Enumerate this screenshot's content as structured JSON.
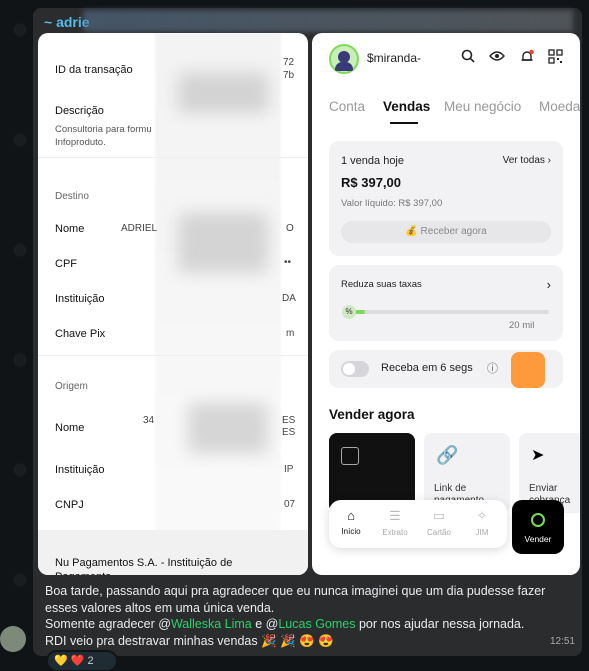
{
  "sender_name": "~ adrie",
  "left_screen": {
    "transaction_id_label": "ID da transação",
    "transaction_id_partial_1": "72",
    "transaction_id_partial_2": "7b",
    "description_label": "Descrição",
    "description_value": "Consultoria para formu\nInfoproduto.",
    "destino_label": "Destino",
    "nome_label": "Nome",
    "nome_value_start": "ADRIEL",
    "nome_value_end": "O",
    "cpf_label": "CPF",
    "cpf_value_end": "••",
    "instituicao_label": "Instituição",
    "instituicao_value_end": "DA",
    "chave_pix_label": "Chave Pix",
    "chave_pix_value_end": "m",
    "origem_label": "Origem",
    "origem_nome_label": "Nome",
    "origem_nome_value_start": "34",
    "origem_nome_value_end": "ES\nES",
    "origem_instituicao_label": "Instituição",
    "origem_instituicao_value_end": "IP",
    "cnpj_label": "CNPJ",
    "cnpj_value_end": "07",
    "bank_name": "Nu Pagamentos S.A. - Instituição de Pagamento"
  },
  "right_screen": {
    "username": "$miranda-",
    "tabs": [
      "Conta",
      "Vendas",
      "Meu negócio",
      "Moeda"
    ],
    "active_tab": "Vendas",
    "sales_card": {
      "count_label": "1 venda hoje",
      "see_all": "Ver todas",
      "amount": "R$ 397,00",
      "net_label": "Valor líquido: R$ 397,00",
      "receive_button": "Receber agora"
    },
    "fees_card": {
      "title": "Reduza suas taxas",
      "progress_fraction": 0.08,
      "target_label": "20 mil"
    },
    "toggle_card": {
      "label": "Receba em 6 segs"
    },
    "sell_now_title": "Vender agora",
    "tiles": [
      {
        "label": ""
      },
      {
        "label": "Link de\npagamento"
      },
      {
        "label": "Enviar\ncobrança"
      }
    ],
    "bottom_nav": [
      {
        "icon": "home-icon",
        "label": "Início"
      },
      {
        "icon": "list-icon",
        "label": "Extrato"
      },
      {
        "icon": "card-icon",
        "label": "Cartão"
      },
      {
        "icon": "sparkles-icon",
        "label": "JIM"
      }
    ],
    "sell_button": "Vender"
  },
  "message": {
    "line1": "Boa tarde, passando aqui pra agradecer que eu nunca imaginei que um dia pudesse fazer esses valores altos em uma única venda.",
    "line2_prefix": "Somente agradecer @",
    "mention1": "Walleska Lima",
    "line2_mid": " e @",
    "mention2": "Lucas Gomes",
    "line2_suffix": " por nos ajudar nessa jornada.",
    "line3": "RDI veio pra destravar minhas vendas 🎉 🎉 😍 😍",
    "time": "12:51"
  },
  "reactions": {
    "emojis": "💛 ❤️",
    "count": "2"
  },
  "colors": {
    "accent_green": "#7ed957",
    "mention_green": "#25d366",
    "sender_blue": "#53bdeb",
    "bubble_bg": "#2b2c2e"
  }
}
